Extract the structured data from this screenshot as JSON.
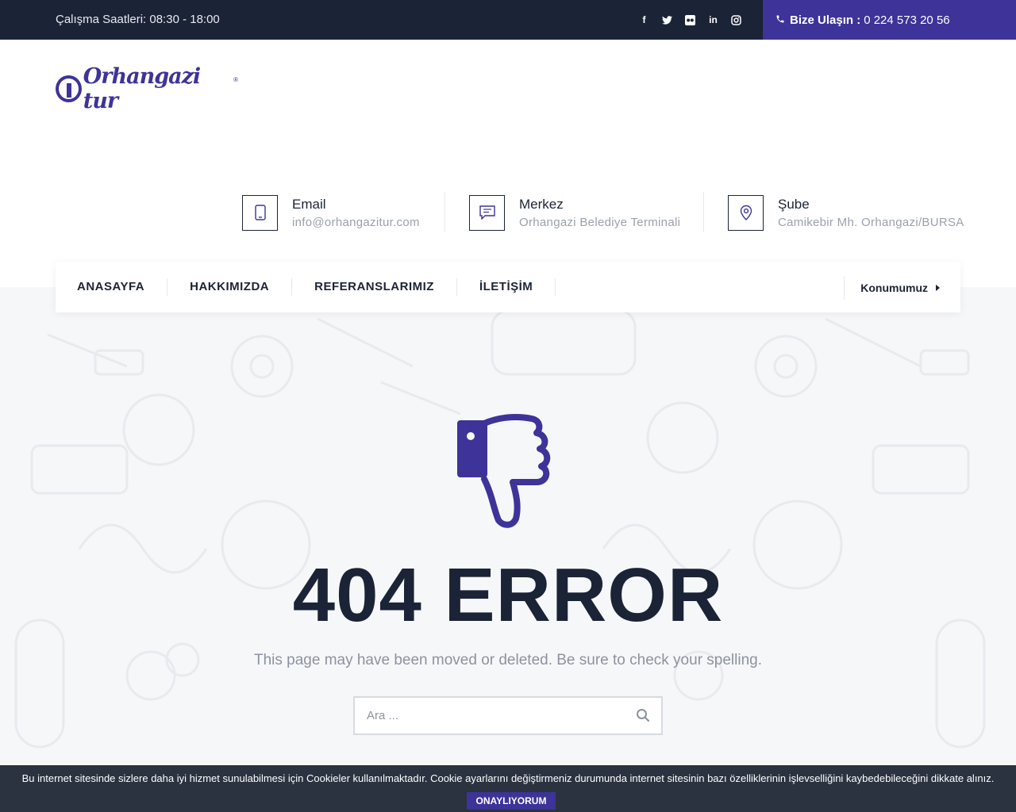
{
  "topbar": {
    "hours": "Çalışma Saatleri: 08:30 - 18:00",
    "socials": [
      {
        "icon": "facebook-icon",
        "glyph": "f"
      },
      {
        "icon": "twitter-icon",
        "glyph": "✦"
      },
      {
        "icon": "flickr-icon",
        "glyph": "●●"
      },
      {
        "icon": "linkedin-icon",
        "glyph": "in"
      },
      {
        "icon": "instagram-icon",
        "glyph": "◎"
      }
    ],
    "contact_label": "Bize Ulaşın :",
    "contact_phone": "0 224 573 20 56"
  },
  "logo": {
    "text": "Orhangazi tur",
    "reg": "®"
  },
  "info": [
    {
      "icon": "phone-icon",
      "title": "Email",
      "sub": "info@orhangazitur.com"
    },
    {
      "icon": "message-icon",
      "title": "Merkez",
      "sub": "Orhangazi Belediye Terminali"
    },
    {
      "icon": "location-pin-icon",
      "title": "Şube",
      "sub": "Camikebir Mh. Orhangazi/BURSA"
    }
  ],
  "nav": {
    "items": [
      "ANASAYFA",
      "HAKKIMIZDA",
      "REFERANSLARIMIZ",
      "İLETİŞİM"
    ],
    "location": "Konumumuz"
  },
  "error": {
    "title": "404 ERROR",
    "message": "This page may have been moved or deleted. Be sure to check your spelling."
  },
  "search": {
    "placeholder": "Ara ..."
  },
  "cookie": {
    "text": "Bu internet sitesinde sizlere daha iyi hizmet sunulabilmesi için Cookieler kullanılmaktadır. Cookie ayarlarını değiştirmeniz durumunda internet sitesinin bazı özelliklerinin işlevselliğini kaybedebileceğini dikkate alınız.",
    "button": "ONAYLIYORUM"
  },
  "colors": {
    "dark": "#1b2336",
    "accent": "#3d3399",
    "muted": "#8d92a0",
    "cookie_bg": "#2b3240"
  }
}
